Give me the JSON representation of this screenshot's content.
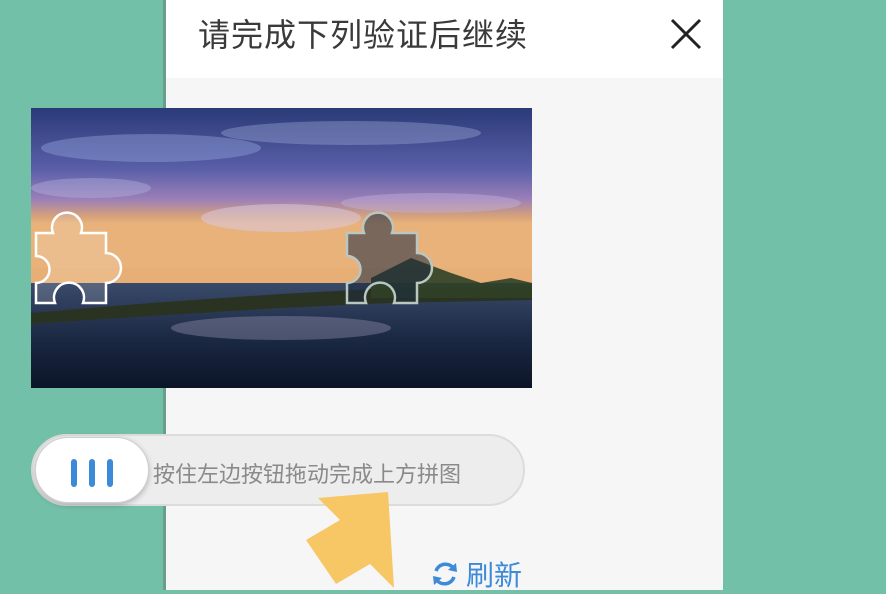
{
  "dialog": {
    "title": "请完成下列验证后继续",
    "close_icon": "close-icon"
  },
  "slider": {
    "hint": "按住左边按钮拖动完成上方拼图",
    "handle_icon": "grip-bars-icon"
  },
  "refresh": {
    "label": "刷新",
    "icon": "refresh-icon"
  },
  "colors": {
    "background": "#72c0a8",
    "accent": "#3d8ad8",
    "arrow": "#f7c766"
  }
}
